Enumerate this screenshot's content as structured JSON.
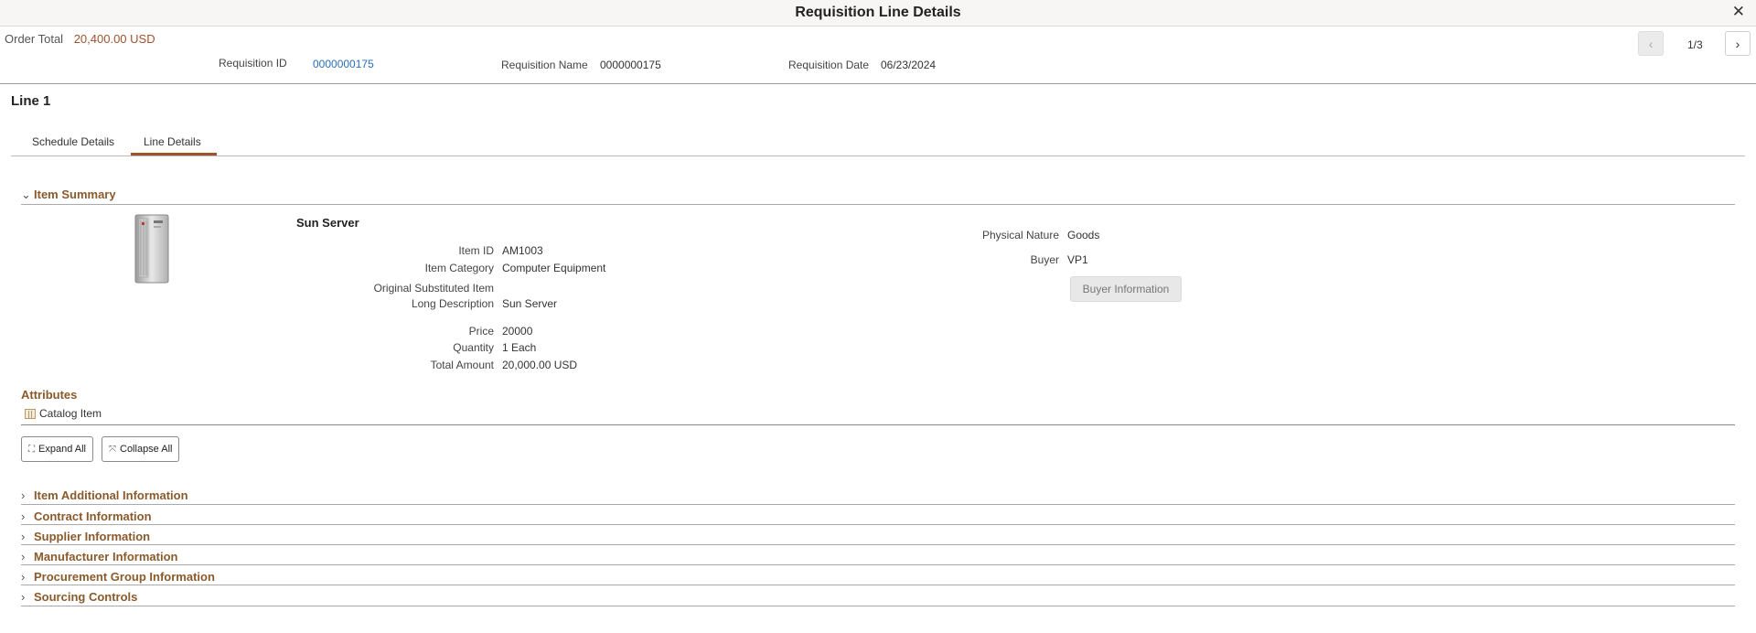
{
  "window": {
    "title": "Requisition Line Details",
    "close_glyph": "✕"
  },
  "header": {
    "order_total_label": "Order Total",
    "order_total_value": "20,400.00 USD",
    "requisition_id_label": "Requisition ID",
    "requisition_id_value": "0000000175",
    "requisition_name_label": "Requisition Name",
    "requisition_name_value": "0000000175",
    "requisition_date_label": "Requisition Date",
    "requisition_date_value": "06/23/2024",
    "pager": "1/3",
    "prev_glyph": "‹",
    "next_glyph": "›"
  },
  "line": {
    "title": "Line 1"
  },
  "tabs": [
    {
      "label": "Schedule Details",
      "active": false
    },
    {
      "label": "Line Details",
      "active": true
    }
  ],
  "item_summary": {
    "header": "Item Summary",
    "item_name": "Sun Server",
    "image_icon": "server-image",
    "fields": {
      "item_id_label": "Item ID",
      "item_id_value": "AM1003",
      "item_category_label": "Item Category",
      "item_category_value": "Computer Equipment",
      "original_substituted_label": "Original Substituted Item",
      "original_substituted_value": "",
      "long_description_label": "Long Description",
      "long_description_value": "Sun Server",
      "price_label": "Price",
      "price_value": "20000",
      "quantity_label": "Quantity",
      "quantity_value": "1 Each",
      "total_amount_label": "Total Amount",
      "total_amount_value": "20,000.00 USD",
      "physical_nature_label": "Physical Nature",
      "physical_nature_value": "Goods",
      "buyer_label": "Buyer",
      "buyer_value": "VP1"
    },
    "buyer_button": "Buyer Information"
  },
  "attributes": {
    "title": "Attributes",
    "item": "Catalog Item",
    "icon": "catalog-icon"
  },
  "buttons": {
    "expand_all": "Expand All",
    "collapse_all": "Collapse All"
  },
  "sections": [
    "Item Additional Information",
    "Contract Information",
    "Supplier Information",
    "Manufacturer Information",
    "Procurement Group Information",
    "Sourcing Controls"
  ],
  "colors": {
    "accent": "#a0522d",
    "section_header": "#8b5a2b",
    "link": "#2a6fbb"
  }
}
